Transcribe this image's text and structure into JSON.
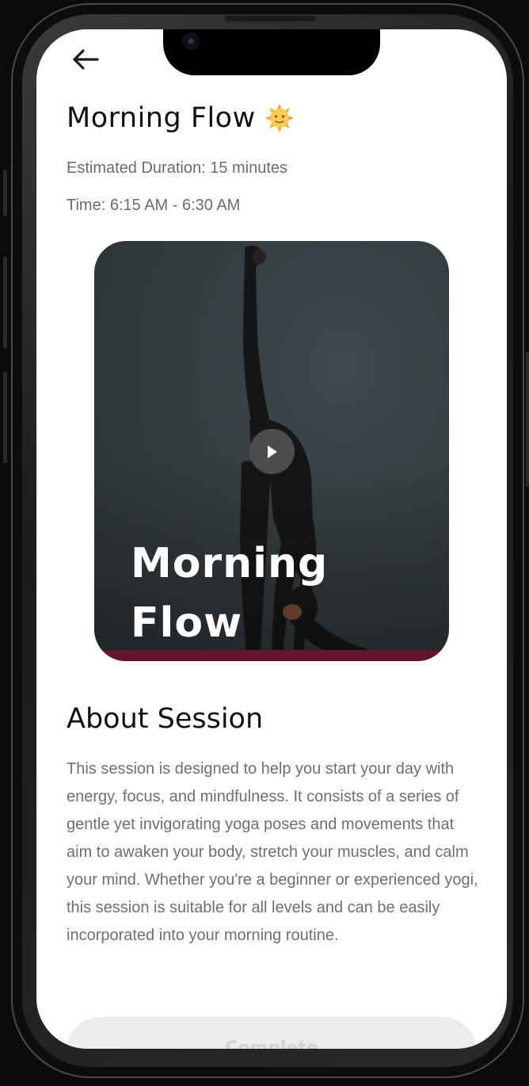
{
  "header": {
    "back_icon": "arrow-left-icon"
  },
  "session": {
    "title": "Morning Flow",
    "title_icon": "sun-face-icon",
    "duration_text": "Estimated Duration: 15 minutes",
    "time_text": "Time: 6:15 AM - 6:30 AM"
  },
  "media": {
    "card_title": "Morning Flow",
    "play_icon": "play-icon"
  },
  "about": {
    "heading": "About Session",
    "description": "This session is designed to help you start your day with energy, focus, and mindfulness. It consists of a series of gentle yet invigorating yoga poses and movements that aim to awaken your body, stretch your muscles, and calm your mind. Whether you're a beginner or experienced yogi, this session is suitable for all levels and can be easily incorporated into your morning routine."
  },
  "actions": {
    "complete_label": "Complete"
  },
  "colors": {
    "mat": "#8a1d3e",
    "card_bg": "#323a3e",
    "button_bg": "#ececec"
  }
}
